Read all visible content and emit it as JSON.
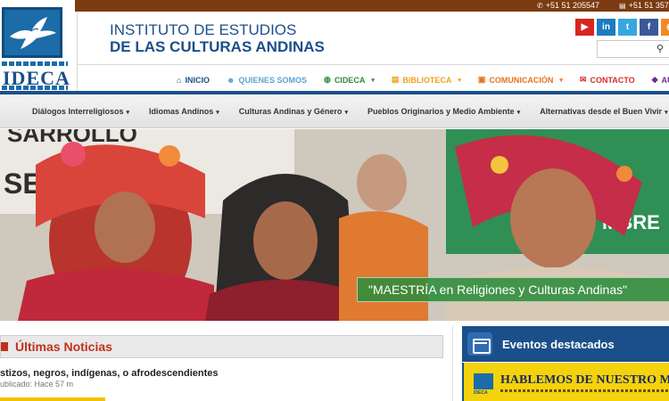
{
  "topbar": {
    "phone": "+51 51 205547",
    "fax": "+51 51 357"
  },
  "logo": {
    "brand": "IDECA"
  },
  "header": {
    "title_line1": "INSTITUTO DE ESTUDIOS",
    "title_line2": "DE LAS CULTURAS ANDINAS"
  },
  "social": {
    "youtube_label": "▶",
    "linkedin_label": "in",
    "twitter_label": "t",
    "facebook_label": "f",
    "extra_label": "◉"
  },
  "search": {
    "placeholder": ""
  },
  "main_nav": {
    "inicio": "INICIO",
    "quienes": "QUIENES SOMOS",
    "cideca": "CIDECA",
    "biblioteca": "BIBLIOTECA",
    "comunicacion": "COMUNICACIÓN",
    "contacto": "CONTACTO",
    "aula": "AULA VIRTUA"
  },
  "sub_nav": {
    "item1": "Diálogos Interreligiosos",
    "item2": "Idiomas Andinos",
    "item3": "Culturas Andinas y Género",
    "item4": "Pueblos Originarios y Medio Ambiente",
    "item5": "Alternativas desde el Buen Vivir"
  },
  "hero": {
    "banner_text": "SARROLLO",
    "banner_text2": "SERVI",
    "banner_text3": "MBRE",
    "caption": "\"MAESTRÍA en Religiones y Culturas Andinas\""
  },
  "news": {
    "heading": "Últimas Noticias",
    "item_title": "stizos, negros, indígenas, o afrodescendientes",
    "item_date": "ublicado: Hace 57 m"
  },
  "events": {
    "heading": "Eventos destacados",
    "banner_title": "HABLEMOS DE NUESTRO MUNDO",
    "banner_logo": "IDECA"
  },
  "colors": {
    "brand_blue": "#1b4f8a",
    "top_brown": "#7a3b10",
    "news_red": "#c0311d",
    "caption_green": "#2e8c3c",
    "event_yellow": "#f4d20c"
  }
}
